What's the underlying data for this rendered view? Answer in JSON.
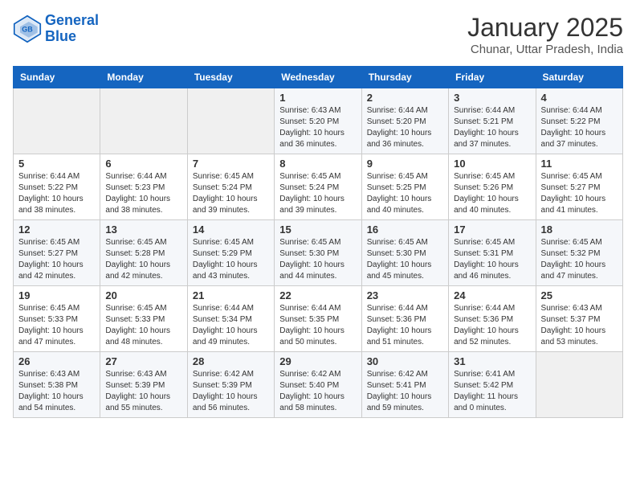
{
  "header": {
    "logo_line1": "General",
    "logo_line2": "Blue",
    "month": "January 2025",
    "location": "Chunar, Uttar Pradesh, India"
  },
  "days_of_week": [
    "Sunday",
    "Monday",
    "Tuesday",
    "Wednesday",
    "Thursday",
    "Friday",
    "Saturday"
  ],
  "weeks": [
    [
      {
        "day": "",
        "info": ""
      },
      {
        "day": "",
        "info": ""
      },
      {
        "day": "",
        "info": ""
      },
      {
        "day": "1",
        "info": "Sunrise: 6:43 AM\nSunset: 5:20 PM\nDaylight: 10 hours and 36 minutes."
      },
      {
        "day": "2",
        "info": "Sunrise: 6:44 AM\nSunset: 5:20 PM\nDaylight: 10 hours and 36 minutes."
      },
      {
        "day": "3",
        "info": "Sunrise: 6:44 AM\nSunset: 5:21 PM\nDaylight: 10 hours and 37 minutes."
      },
      {
        "day": "4",
        "info": "Sunrise: 6:44 AM\nSunset: 5:22 PM\nDaylight: 10 hours and 37 minutes."
      }
    ],
    [
      {
        "day": "5",
        "info": "Sunrise: 6:44 AM\nSunset: 5:22 PM\nDaylight: 10 hours and 38 minutes."
      },
      {
        "day": "6",
        "info": "Sunrise: 6:44 AM\nSunset: 5:23 PM\nDaylight: 10 hours and 38 minutes."
      },
      {
        "day": "7",
        "info": "Sunrise: 6:45 AM\nSunset: 5:24 PM\nDaylight: 10 hours and 39 minutes."
      },
      {
        "day": "8",
        "info": "Sunrise: 6:45 AM\nSunset: 5:24 PM\nDaylight: 10 hours and 39 minutes."
      },
      {
        "day": "9",
        "info": "Sunrise: 6:45 AM\nSunset: 5:25 PM\nDaylight: 10 hours and 40 minutes."
      },
      {
        "day": "10",
        "info": "Sunrise: 6:45 AM\nSunset: 5:26 PM\nDaylight: 10 hours and 40 minutes."
      },
      {
        "day": "11",
        "info": "Sunrise: 6:45 AM\nSunset: 5:27 PM\nDaylight: 10 hours and 41 minutes."
      }
    ],
    [
      {
        "day": "12",
        "info": "Sunrise: 6:45 AM\nSunset: 5:27 PM\nDaylight: 10 hours and 42 minutes."
      },
      {
        "day": "13",
        "info": "Sunrise: 6:45 AM\nSunset: 5:28 PM\nDaylight: 10 hours and 42 minutes."
      },
      {
        "day": "14",
        "info": "Sunrise: 6:45 AM\nSunset: 5:29 PM\nDaylight: 10 hours and 43 minutes."
      },
      {
        "day": "15",
        "info": "Sunrise: 6:45 AM\nSunset: 5:30 PM\nDaylight: 10 hours and 44 minutes."
      },
      {
        "day": "16",
        "info": "Sunrise: 6:45 AM\nSunset: 5:30 PM\nDaylight: 10 hours and 45 minutes."
      },
      {
        "day": "17",
        "info": "Sunrise: 6:45 AM\nSunset: 5:31 PM\nDaylight: 10 hours and 46 minutes."
      },
      {
        "day": "18",
        "info": "Sunrise: 6:45 AM\nSunset: 5:32 PM\nDaylight: 10 hours and 47 minutes."
      }
    ],
    [
      {
        "day": "19",
        "info": "Sunrise: 6:45 AM\nSunset: 5:33 PM\nDaylight: 10 hours and 47 minutes."
      },
      {
        "day": "20",
        "info": "Sunrise: 6:45 AM\nSunset: 5:33 PM\nDaylight: 10 hours and 48 minutes."
      },
      {
        "day": "21",
        "info": "Sunrise: 6:44 AM\nSunset: 5:34 PM\nDaylight: 10 hours and 49 minutes."
      },
      {
        "day": "22",
        "info": "Sunrise: 6:44 AM\nSunset: 5:35 PM\nDaylight: 10 hours and 50 minutes."
      },
      {
        "day": "23",
        "info": "Sunrise: 6:44 AM\nSunset: 5:36 PM\nDaylight: 10 hours and 51 minutes."
      },
      {
        "day": "24",
        "info": "Sunrise: 6:44 AM\nSunset: 5:36 PM\nDaylight: 10 hours and 52 minutes."
      },
      {
        "day": "25",
        "info": "Sunrise: 6:43 AM\nSunset: 5:37 PM\nDaylight: 10 hours and 53 minutes."
      }
    ],
    [
      {
        "day": "26",
        "info": "Sunrise: 6:43 AM\nSunset: 5:38 PM\nDaylight: 10 hours and 54 minutes."
      },
      {
        "day": "27",
        "info": "Sunrise: 6:43 AM\nSunset: 5:39 PM\nDaylight: 10 hours and 55 minutes."
      },
      {
        "day": "28",
        "info": "Sunrise: 6:42 AM\nSunset: 5:39 PM\nDaylight: 10 hours and 56 minutes."
      },
      {
        "day": "29",
        "info": "Sunrise: 6:42 AM\nSunset: 5:40 PM\nDaylight: 10 hours and 58 minutes."
      },
      {
        "day": "30",
        "info": "Sunrise: 6:42 AM\nSunset: 5:41 PM\nDaylight: 10 hours and 59 minutes."
      },
      {
        "day": "31",
        "info": "Sunrise: 6:41 AM\nSunset: 5:42 PM\nDaylight: 11 hours and 0 minutes."
      },
      {
        "day": "",
        "info": ""
      }
    ]
  ]
}
